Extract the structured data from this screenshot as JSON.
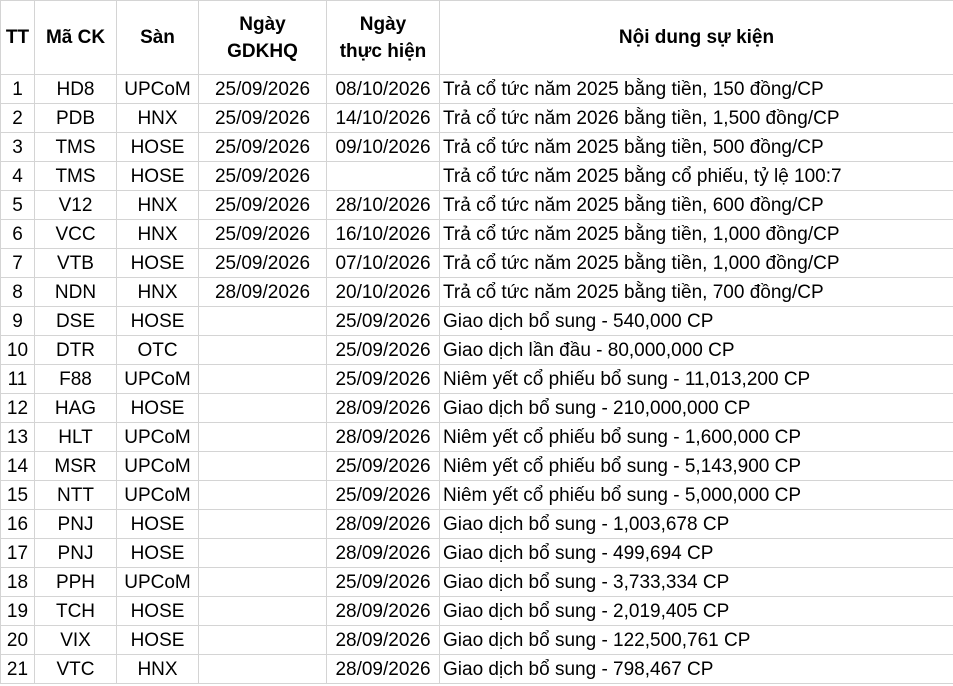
{
  "headers": {
    "tt": "TT",
    "ma_ck": "Mã CK",
    "san": "Sàn",
    "ngay_gdkhq_line1": "Ngày",
    "ngay_gdkhq_line2": "GDKHQ",
    "ngay_thuc_hien_line1": "Ngày",
    "ngay_thuc_hien_line2": "thực hiện",
    "noi_dung": "Nội dung sự kiện"
  },
  "rows": [
    {
      "tt": "1",
      "ma": "HD8",
      "san": "UPCoM",
      "gdkhq": "25/09/2026",
      "thuc_hien": "08/10/2026",
      "noi_dung": "Trả cổ tức năm 2025 bằng tiền, 150 đồng/CP"
    },
    {
      "tt": "2",
      "ma": "PDB",
      "san": "HNX",
      "gdkhq": "25/09/2026",
      "thuc_hien": "14/10/2026",
      "noi_dung": "Trả cổ tức năm 2026 bằng tiền, 1,500 đồng/CP"
    },
    {
      "tt": "3",
      "ma": "TMS",
      "san": "HOSE",
      "gdkhq": "25/09/2026",
      "thuc_hien": "09/10/2026",
      "noi_dung": "Trả cổ tức năm 2025 bằng tiền, 500 đồng/CP"
    },
    {
      "tt": "4",
      "ma": "TMS",
      "san": "HOSE",
      "gdkhq": "25/09/2026",
      "thuc_hien": "",
      "noi_dung": "Trả cổ tức năm 2025 bằng cổ phiếu, tỷ lệ 100:7"
    },
    {
      "tt": "5",
      "ma": "V12",
      "san": "HNX",
      "gdkhq": "25/09/2026",
      "thuc_hien": "28/10/2026",
      "noi_dung": "Trả cổ tức năm 2025 bằng tiền, 600 đồng/CP"
    },
    {
      "tt": "6",
      "ma": "VCC",
      "san": "HNX",
      "gdkhq": "25/09/2026",
      "thuc_hien": "16/10/2026",
      "noi_dung": "Trả cổ tức năm 2025 bằng tiền, 1,000 đồng/CP"
    },
    {
      "tt": "7",
      "ma": "VTB",
      "san": "HOSE",
      "gdkhq": "25/09/2026",
      "thuc_hien": "07/10/2026",
      "noi_dung": "Trả cổ tức năm 2025 bằng tiền, 1,000 đồng/CP"
    },
    {
      "tt": "8",
      "ma": "NDN",
      "san": "HNX",
      "gdkhq": "28/09/2026",
      "thuc_hien": "20/10/2026",
      "noi_dung": "Trả cổ tức năm 2025 bằng tiền, 700 đồng/CP"
    },
    {
      "tt": "9",
      "ma": "DSE",
      "san": "HOSE",
      "gdkhq": "",
      "thuc_hien": "25/09/2026",
      "noi_dung": "Giao dịch bổ sung - 540,000 CP"
    },
    {
      "tt": "10",
      "ma": "DTR",
      "san": "OTC",
      "gdkhq": "",
      "thuc_hien": "25/09/2026",
      "noi_dung": "Giao dịch lần đầu - 80,000,000 CP"
    },
    {
      "tt": "11",
      "ma": "F88",
      "san": "UPCoM",
      "gdkhq": "",
      "thuc_hien": "25/09/2026",
      "noi_dung": "Niêm yết cổ phiếu bổ sung - 11,013,200 CP"
    },
    {
      "tt": "12",
      "ma": "HAG",
      "san": "HOSE",
      "gdkhq": "",
      "thuc_hien": "28/09/2026",
      "noi_dung": "Giao dịch bổ sung - 210,000,000 CP"
    },
    {
      "tt": "13",
      "ma": "HLT",
      "san": "UPCoM",
      "gdkhq": "",
      "thuc_hien": "28/09/2026",
      "noi_dung": "Niêm yết cổ phiếu bổ sung - 1,600,000 CP"
    },
    {
      "tt": "14",
      "ma": "MSR",
      "san": "UPCoM",
      "gdkhq": "",
      "thuc_hien": "25/09/2026",
      "noi_dung": "Niêm yết cổ phiếu bổ sung - 5,143,900 CP"
    },
    {
      "tt": "15",
      "ma": "NTT",
      "san": "UPCoM",
      "gdkhq": "",
      "thuc_hien": "25/09/2026",
      "noi_dung": "Niêm yết cổ phiếu bổ sung - 5,000,000 CP"
    },
    {
      "tt": "16",
      "ma": "PNJ",
      "san": "HOSE",
      "gdkhq": "",
      "thuc_hien": "28/09/2026",
      "noi_dung": "Giao dịch bổ sung - 1,003,678 CP"
    },
    {
      "tt": "17",
      "ma": "PNJ",
      "san": "HOSE",
      "gdkhq": "",
      "thuc_hien": "28/09/2026",
      "noi_dung": "Giao dịch bổ sung - 499,694 CP"
    },
    {
      "tt": "18",
      "ma": "PPH",
      "san": "UPCoM",
      "gdkhq": "",
      "thuc_hien": "25/09/2026",
      "noi_dung": "Giao dịch bổ sung - 3,733,334 CP"
    },
    {
      "tt": "19",
      "ma": "TCH",
      "san": "HOSE",
      "gdkhq": "",
      "thuc_hien": "28/09/2026",
      "noi_dung": "Giao dịch bổ sung - 2,019,405 CP"
    },
    {
      "tt": "20",
      "ma": "VIX",
      "san": "HOSE",
      "gdkhq": "",
      "thuc_hien": "28/09/2026",
      "noi_dung": "Giao dịch bổ sung - 122,500,761 CP"
    },
    {
      "tt": "21",
      "ma": "VTC",
      "san": "HNX",
      "gdkhq": "",
      "thuc_hien": "28/09/2026",
      "noi_dung": "Giao dịch bổ sung - 798,467 CP"
    }
  ]
}
